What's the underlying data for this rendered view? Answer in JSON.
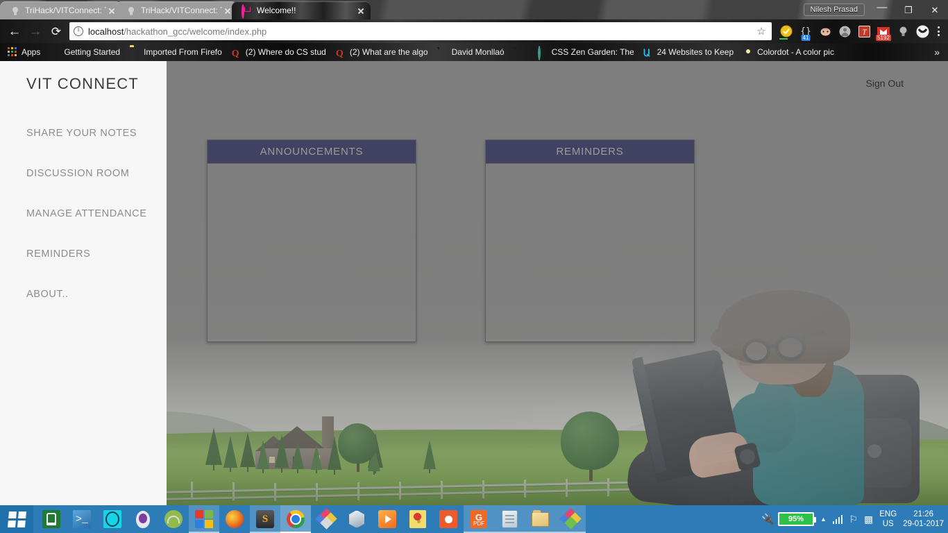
{
  "window": {
    "user_chip": "Nilesh Prasad",
    "minimize_label": "—",
    "restore_label": "❐",
    "close_label": "✕"
  },
  "browser": {
    "tabs": [
      {
        "title": "TriHack/VITConnect: This",
        "favicon": "github-icon",
        "active": false,
        "close_label": "✕"
      },
      {
        "title": "TriHack/VITConnect: This",
        "favicon": "github-icon",
        "active": false,
        "close_label": "✕"
      },
      {
        "title": "Welcome!!",
        "favicon": "pink-logo-icon",
        "active": true,
        "close_label": "✕"
      }
    ],
    "nav": {
      "back_label": "←",
      "forward_label": "→",
      "reload_label": "⟳"
    },
    "omnibox": {
      "info_icon": "info-circle-icon",
      "url_host": "localhost",
      "url_path": "/hackathon_gcc/welcome/index.php",
      "full_url": "localhost/hackathon_gcc/welcome/index.php",
      "bookmark_star": "☆"
    },
    "extensions": [
      {
        "name": "adblock-check-icon",
        "badge": "",
        "color": "#f2c014"
      },
      {
        "name": "code-braces-icon",
        "badge": "41",
        "badge_color": "#2f7fe0",
        "color": "#d8d8d8"
      },
      {
        "name": "face-avatar-icon",
        "badge": "",
        "color": "#e5b9a0"
      },
      {
        "name": "user-circle-icon",
        "badge": "",
        "color": "#b9b9b9"
      },
      {
        "name": "todoist-t-icon",
        "badge": "",
        "color": "#c0392b"
      },
      {
        "name": "gmail-envelope-icon",
        "badge": "5192",
        "badge_color": "#e23b2e",
        "color": "#d93025"
      },
      {
        "name": "lightbulb-icon",
        "badge": "",
        "color": "#b5b5b5"
      },
      {
        "name": "pocket-circle-icon",
        "badge": "",
        "color": "#f0f0f0"
      }
    ],
    "menu_icon": "kebab-menu-icon",
    "bookmarks": [
      {
        "label": "Apps",
        "icon": "apps-grid-icon"
      },
      {
        "label": "Getting Started",
        "icon": "document-icon"
      },
      {
        "label": "Imported From Firefo",
        "icon": "folder-icon"
      },
      {
        "label": "(2) Where do CS stud",
        "icon": "quora-icon"
      },
      {
        "label": "(2) What are the algo",
        "icon": "quora-icon"
      },
      {
        "label": "David Monllaó",
        "icon": "document-icon"
      },
      {
        "label": "",
        "icon": "document-icon"
      },
      {
        "label": "CSS Zen Garden: The",
        "icon": "zen-circle-icon"
      },
      {
        "label": "24 Websites to Keep",
        "icon": "u-letter-icon"
      },
      {
        "label": "Colordot - A color pic",
        "icon": "colordot-icon"
      }
    ],
    "bookmarks_overflow": "»"
  },
  "page": {
    "sidebar": {
      "brand": "VIT CONNECT",
      "items": [
        {
          "label": "SHARE YOUR NOTES"
        },
        {
          "label": "DISCUSSION ROOM"
        },
        {
          "label": "MANAGE ATTENDANCE"
        },
        {
          "label": "REMINDERS"
        },
        {
          "label": "ABOUT.."
        }
      ]
    },
    "header": {
      "sign_out": "Sign Out"
    },
    "panels": [
      {
        "title": "ANNOUNCEMENTS",
        "body": ""
      },
      {
        "title": "REMINDERS",
        "body": ""
      }
    ],
    "colors": {
      "panel_header_bg": "#414162",
      "panel_header_text": "#9c9c9c",
      "sidebar_bg": "#f7f7f7",
      "overlay_gray": "#808080"
    }
  },
  "taskbar": {
    "start_label": "start-windows-icon",
    "items": [
      {
        "name": "windows-store-icon",
        "state": "idle"
      },
      {
        "name": "powershell-icon",
        "state": "idle"
      },
      {
        "name": "cyan-app-icon",
        "state": "idle"
      },
      {
        "name": "purple-egg-icon",
        "state": "idle"
      },
      {
        "name": "android-studio-icon",
        "state": "idle"
      },
      {
        "name": "microsoft-office-icon",
        "state": "open"
      },
      {
        "name": "firefox-icon",
        "state": "idle"
      },
      {
        "name": "sublime-text-icon",
        "state": "open"
      },
      {
        "name": "google-chrome-icon",
        "state": "active"
      },
      {
        "name": "photoshop-diamond-icon",
        "state": "idle"
      },
      {
        "name": "virtualbox-cube-icon",
        "state": "idle"
      },
      {
        "name": "media-player-icon",
        "state": "idle"
      },
      {
        "name": "sticky-notes-icon",
        "state": "idle"
      },
      {
        "name": "scanner-icon",
        "state": "idle"
      },
      {
        "name": "pdf-reader-icon",
        "state": "open"
      },
      {
        "name": "notepad-icon",
        "state": "open"
      },
      {
        "name": "file-explorer-icon",
        "state": "open"
      },
      {
        "name": "color-diamond-icon",
        "state": "open"
      }
    ],
    "tray": {
      "plug_icon": "power-plug-icon",
      "battery_percent": "95%",
      "overflow_caret": "▲",
      "network_icon": "signal-bars-icon",
      "action_center_icon": "flag-icon",
      "usb_icon": "usb-device-icon",
      "language_line1": "ENG",
      "language_line2": "US",
      "time": "21:26",
      "date": "29-01-2017"
    }
  }
}
